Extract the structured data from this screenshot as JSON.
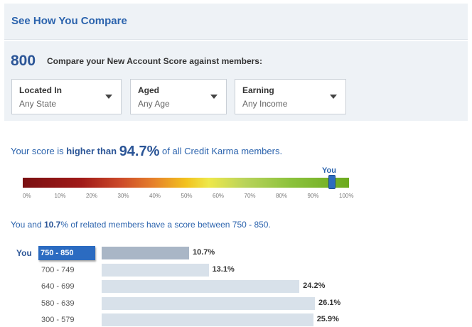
{
  "header": {
    "title": "See How You Compare"
  },
  "filters": {
    "score": "800",
    "compare_text": "Compare your New Account Score against members:",
    "dropdowns": [
      {
        "label": "Located In",
        "value": "Any State"
      },
      {
        "label": "Aged",
        "value": "Any Age"
      },
      {
        "label": "Earning",
        "value": "Any Income"
      }
    ]
  },
  "summary": {
    "prefix": "Your score is ",
    "emphasis": "higher than",
    "percent": "94.7%",
    "suffix": " of all Credit Karma members."
  },
  "gauge": {
    "you_label": "You",
    "you_position_percent": 94.7,
    "ticks": [
      "0%",
      "10%",
      "20%",
      "30%",
      "40%",
      "50%",
      "60%",
      "70%",
      "80%",
      "90%",
      "100%"
    ]
  },
  "related": {
    "prefix": "You and ",
    "percent": "10.7",
    "suffix": "% of related members have a score between 750 - 850."
  },
  "distribution": {
    "you_label": "You",
    "rows": [
      {
        "range": "750 - 850",
        "value": 10.7,
        "label": "10.7%",
        "selected": true
      },
      {
        "range": "700 - 749",
        "value": 13.1,
        "label": "13.1%",
        "selected": false
      },
      {
        "range": "640 - 699",
        "value": 24.2,
        "label": "24.2%",
        "selected": false
      },
      {
        "range": "580 - 639",
        "value": 26.1,
        "label": "26.1%",
        "selected": false
      },
      {
        "range": "300 - 579",
        "value": 25.9,
        "label": "25.9%",
        "selected": false
      }
    ],
    "colors": {
      "selected_range": "#2b6bc1",
      "selected_bar": "#a9b6c6",
      "bar": "#d8e1ea"
    }
  }
}
